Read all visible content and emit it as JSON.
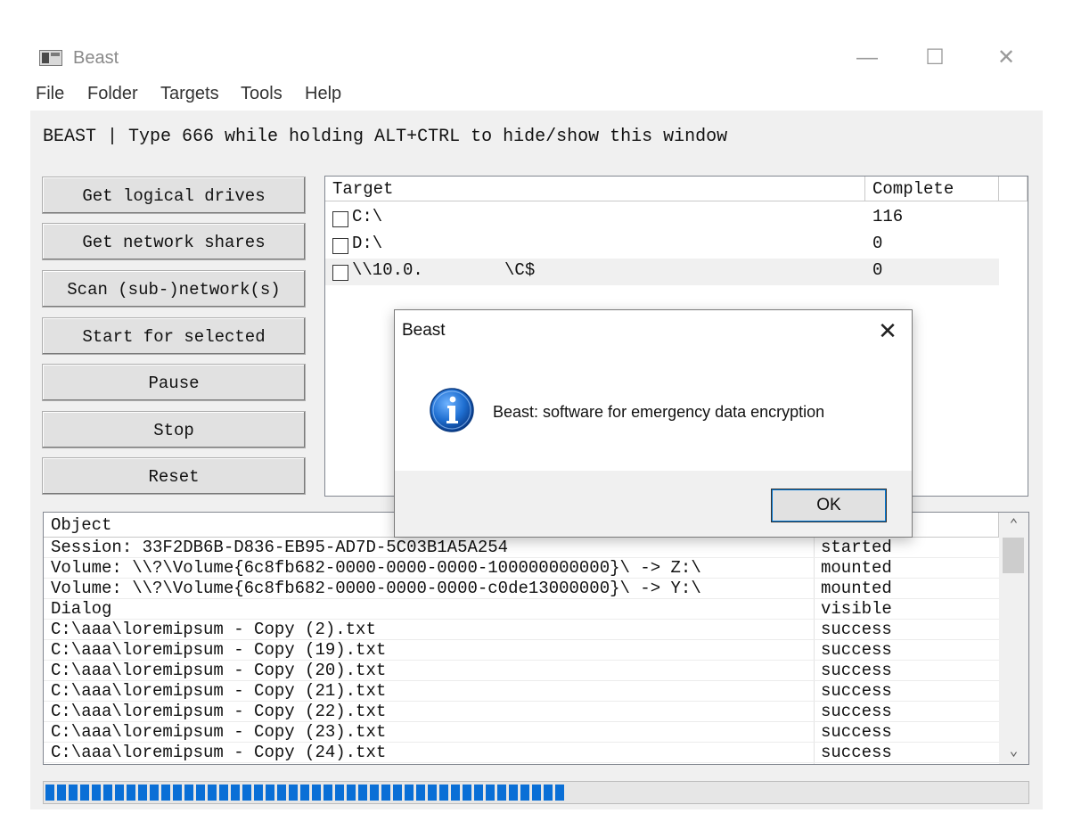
{
  "window": {
    "title": "Beast",
    "controls": {
      "minimize": "—",
      "maximize": "☐",
      "close": "✕"
    }
  },
  "menu": [
    "File",
    "Folder",
    "Targets",
    "Tools",
    "Help"
  ],
  "hint": "BEAST | Type 666 while holding ALT+CTRL to hide/show this window",
  "buttons": {
    "get_logical_drives": "Get logical drives",
    "get_network_shares": "Get network shares",
    "scan_subnetworks": "Scan (sub-)network(s)",
    "start_for_selected": "Start for selected",
    "pause": "Pause",
    "stop": "Stop",
    "reset": "Reset"
  },
  "targets": {
    "columns": [
      "Target",
      "Complete"
    ],
    "rows": [
      {
        "name": "C:\\",
        "complete": "116"
      },
      {
        "name": "D:\\",
        "complete": "0"
      },
      {
        "name": "\\\\10.0.        \\C$",
        "complete": "0"
      }
    ]
  },
  "log": {
    "columns": [
      "Object"
    ],
    "rows": [
      {
        "object": "Session: 33F2DB6B-D836-EB95-AD7D-5C03B1A5A254",
        "status": "started"
      },
      {
        "object": "Volume: \\\\?\\Volume{6c8fb682-0000-0000-0000-100000000000}\\ -> Z:\\",
        "status": "mounted"
      },
      {
        "object": "Volume: \\\\?\\Volume{6c8fb682-0000-0000-0000-c0de13000000}\\ -> Y:\\",
        "status": "mounted"
      },
      {
        "object": "Dialog",
        "status": "visible"
      },
      {
        "object": "C:\\aaa\\loremipsum - Copy (2).txt",
        "status": "success"
      },
      {
        "object": "C:\\aaa\\loremipsum - Copy (19).txt",
        "status": "success"
      },
      {
        "object": "C:\\aaa\\loremipsum - Copy (20).txt",
        "status": "success"
      },
      {
        "object": "C:\\aaa\\loremipsum - Copy (21).txt",
        "status": "success"
      },
      {
        "object": "C:\\aaa\\loremipsum - Copy (22).txt",
        "status": "success"
      },
      {
        "object": "C:\\aaa\\loremipsum - Copy (23).txt",
        "status": "success"
      },
      {
        "object": "C:\\aaa\\loremipsum - Copy (24).txt",
        "status": "success"
      }
    ]
  },
  "progress": {
    "fraction": 0.53,
    "color": "#0a6fd6"
  },
  "dialog": {
    "title": "Beast",
    "close": "✕",
    "message": "Beast: software for emergency data encryption",
    "ok": "OK",
    "icon": "info-icon"
  }
}
